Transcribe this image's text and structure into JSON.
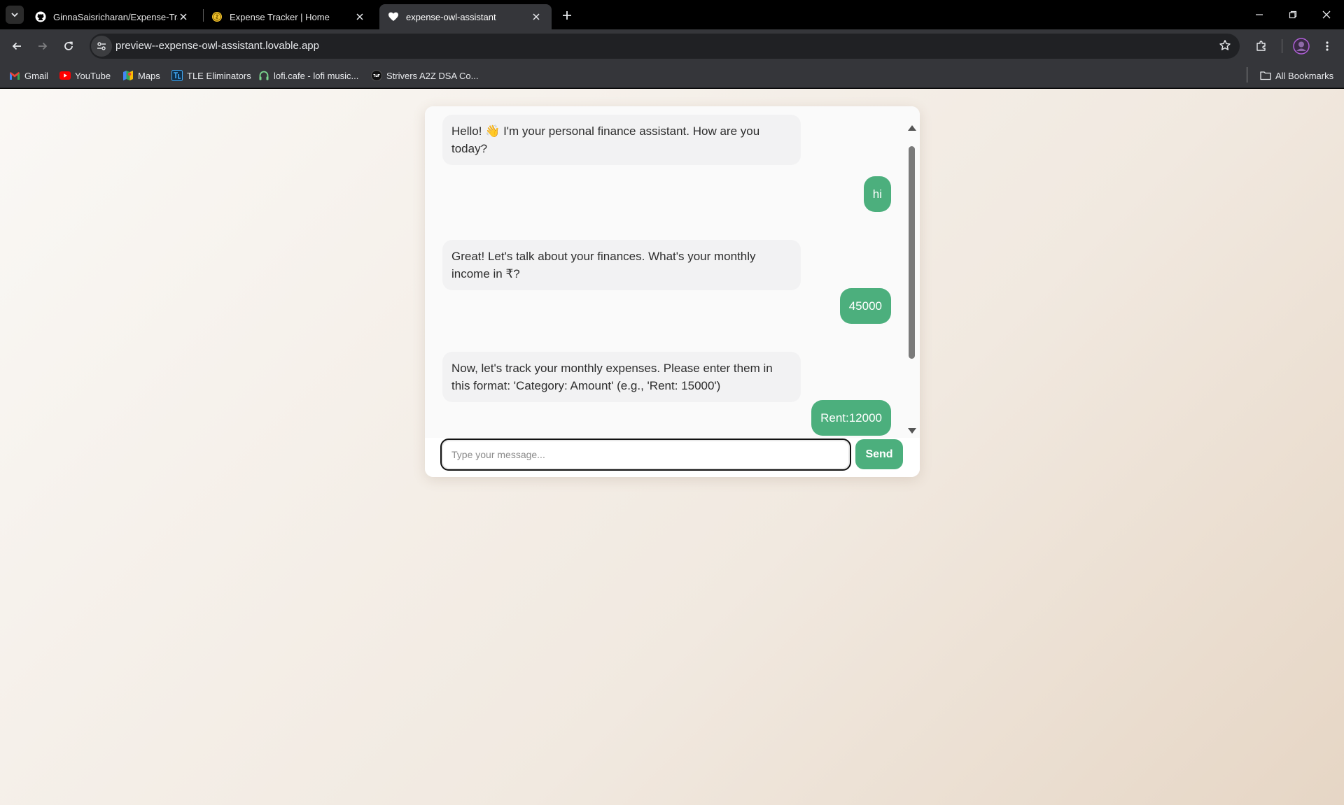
{
  "browser": {
    "tabs": [
      {
        "title": "GinnaSaisricharan/Expense-Tra",
        "icon": "github-icon",
        "active": false
      },
      {
        "title": "Expense Tracker | Home",
        "icon": "coin-icon",
        "active": false
      },
      {
        "title": "expense-owl-assistant",
        "icon": "heart-icon",
        "active": true
      }
    ],
    "url": "preview--expense-owl-assistant.lovable.app",
    "bookmarks": [
      {
        "label": "Gmail",
        "icon": "gmail-icon"
      },
      {
        "label": "YouTube",
        "icon": "youtube-icon"
      },
      {
        "label": "Maps",
        "icon": "maps-icon"
      },
      {
        "label": "TLE Eliminators",
        "icon": "tle-icon"
      },
      {
        "label": "lofi.cafe - lofi music...",
        "icon": "headphones-icon"
      },
      {
        "label": "Strivers A2Z DSA Co...",
        "icon": "tuf-icon"
      }
    ],
    "all_bookmarks_label": "All Bookmarks"
  },
  "chat": {
    "messages": [
      {
        "role": "bot",
        "text": "Hello! 👋 I'm your personal finance assistant. How are you today?"
      },
      {
        "role": "user",
        "text": "hi"
      },
      {
        "role": "bot",
        "text": "Great! Let's talk about your finances. What's your monthly income in ₹?"
      },
      {
        "role": "user",
        "text": "45000"
      },
      {
        "role": "bot",
        "text": "Now, let's track your monthly expenses. Please enter them in this format: 'Category: Amount' (e.g., 'Rent: 15000')"
      },
      {
        "role": "user",
        "text": "Rent:12000"
      }
    ],
    "input": {
      "value": "",
      "placeholder": "Type your message..."
    },
    "send_label": "Send"
  },
  "colors": {
    "accent": "#4caf7d",
    "bot_bubble": "#f2f2f3"
  }
}
